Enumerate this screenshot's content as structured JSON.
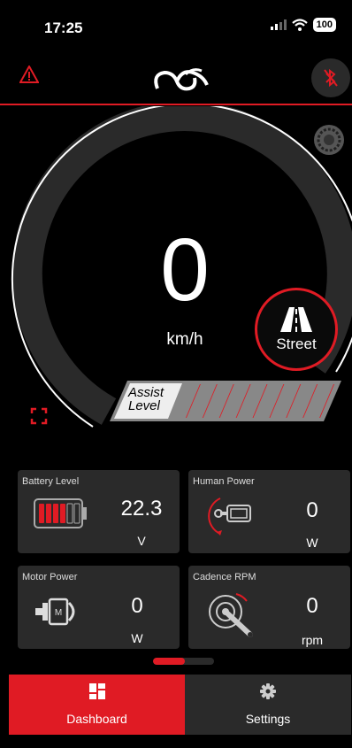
{
  "status_bar": {
    "time": "17:25",
    "battery": "100"
  },
  "speedometer": {
    "speed": "0",
    "unit": "km/h",
    "gauge_level": 0
  },
  "mode": {
    "label": "Street"
  },
  "assist": {
    "label_line1": "Assist",
    "label_line2": "Level",
    "level": 9,
    "max_level": 9
  },
  "cards": {
    "battery": {
      "title": "Battery Level",
      "value": "22.3",
      "unit": "V"
    },
    "human_power": {
      "title": "Human Power",
      "value": "0",
      "unit": "W"
    },
    "motor_power": {
      "title": "Motor Power",
      "value": "0",
      "unit": "W"
    },
    "cadence": {
      "title": "Cadence RPM",
      "value": "0",
      "unit": "rpm"
    }
  },
  "tabs": {
    "dashboard": "Dashboard",
    "settings": "Settings"
  },
  "icons": [
    "warning-icon",
    "logo-icon",
    "bluetooth-off-icon",
    "brake-disc-icon",
    "fullscreen-icon",
    "road-icon",
    "battery-icon",
    "pedal-icon",
    "motor-icon",
    "crank-icon",
    "dashboard-icon",
    "gear-icon"
  ],
  "colors": {
    "accent": "#e01b24",
    "card": "#2a2a2a",
    "background": "#000000"
  }
}
